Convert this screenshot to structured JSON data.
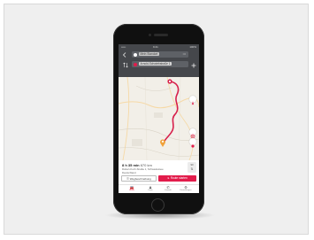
{
  "status_bar": {
    "carrier": "••••• ",
    "time": "9:41",
    "battery": "100%"
  },
  "search": {
    "start": {
      "label": "Mein Standort"
    },
    "destination": {
      "label": "Arnold-Schwiebstraße 1"
    },
    "more_label": "•••"
  },
  "route": {
    "duration": "8 h 35 min",
    "distance": "670 km",
    "address_line1": "Robert-Koch-Straße 1, Schwielowsee",
    "address_line2": "Deutschland"
  },
  "speed_box": {
    "value": "90",
    "unit": "km/h"
  },
  "buttons": {
    "description_label": "Wegbeschreibung",
    "start_label": "Route starten"
  },
  "tabs": [
    {
      "label": "Route",
      "icon": "car-icon"
    },
    {
      "label": "Karte",
      "icon": "person-icon"
    },
    {
      "label": "Kontakt",
      "icon": "phone-icon"
    },
    {
      "label": "Einstellungen",
      "icon": "gear-icon"
    }
  ],
  "colors": {
    "accent": "#e21c4b",
    "toolbar": "#45474b",
    "field": "#5e6166",
    "start_dot": "#ffffff",
    "destination_dot": "#e21c4b"
  }
}
